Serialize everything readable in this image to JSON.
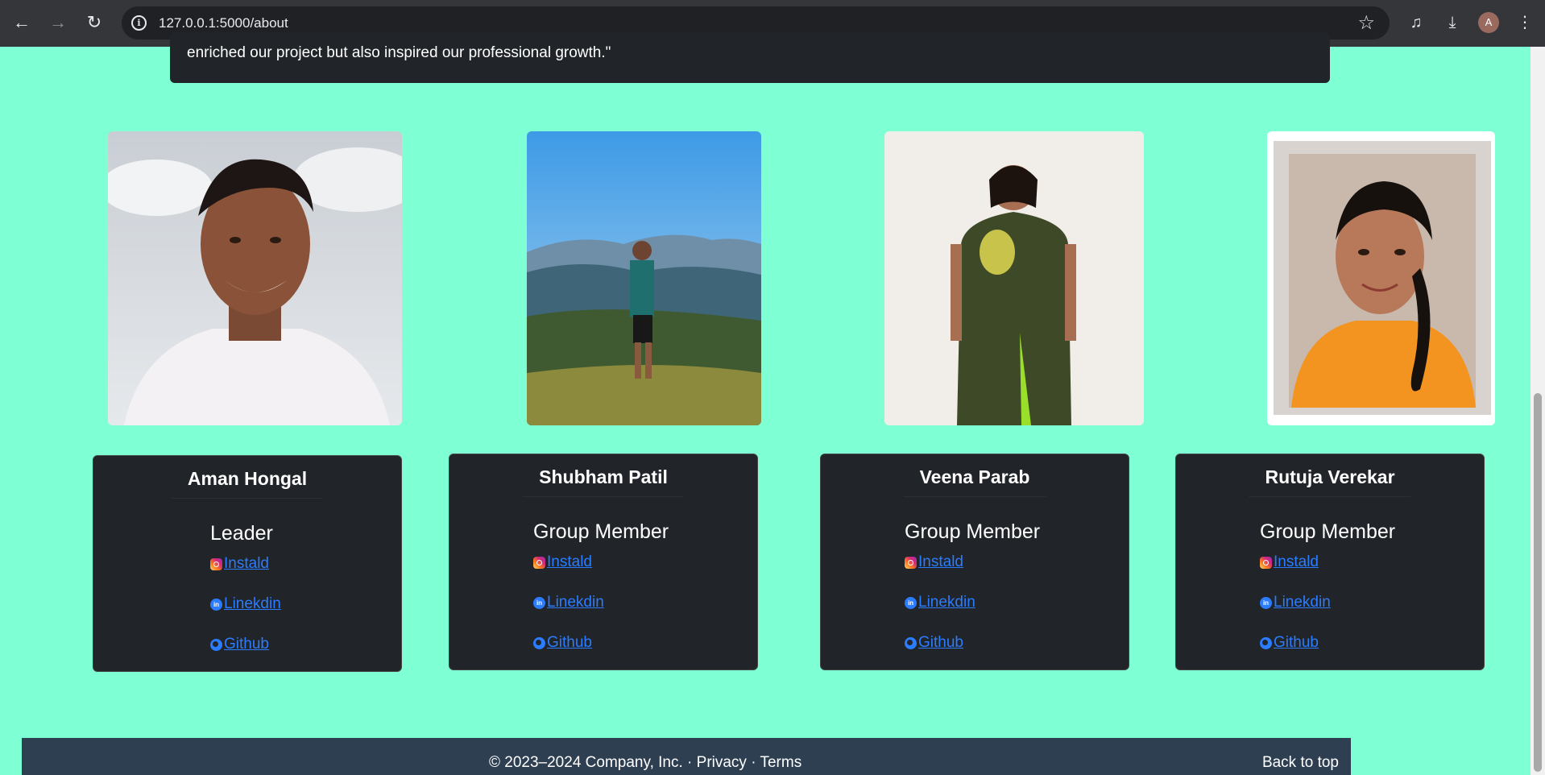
{
  "browser": {
    "url": "127.0.0.1:5000/about",
    "avatar_letter": "A"
  },
  "quote": {
    "text": "enriched our project but also inspired our professional growth.\""
  },
  "members": [
    {
      "name": "Aman Hongal",
      "role": "Leader",
      "insta": "Instald",
      "linkedin": "Linekdin",
      "github": "Github"
    },
    {
      "name": "Shubham Patil",
      "role": "Group Member",
      "insta": "Instald",
      "linkedin": "Linekdin",
      "github": "Github"
    },
    {
      "name": "Veena Parab",
      "role": "Group Member",
      "insta": "Instald",
      "linkedin": "Linekdin",
      "github": "Github"
    },
    {
      "name": "Rutuja Verekar",
      "role": "Group Member",
      "insta": "Instald",
      "linkedin": "Linekdin",
      "github": "Github"
    }
  ],
  "footer": {
    "copyright": "© 2023–2024 Company, Inc. ·",
    "privacy": "Privacy",
    "sep": "·",
    "terms": "Terms",
    "back_to_top": "Back to top"
  },
  "colors": {
    "page_bg": "#7fffd4",
    "card_bg": "#212529",
    "link": "#2b7cff",
    "footer_bg": "#2e3f52"
  }
}
